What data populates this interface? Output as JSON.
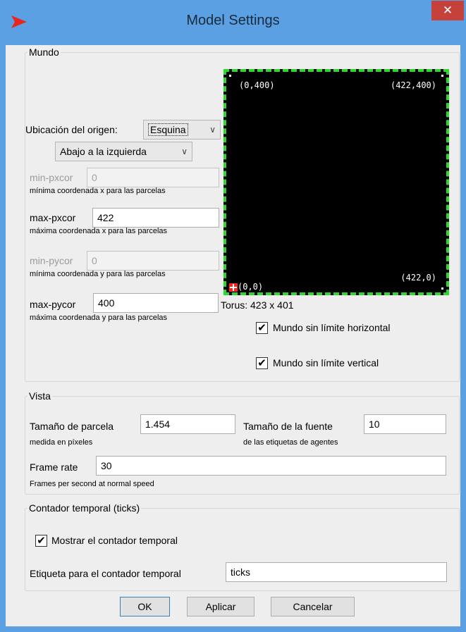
{
  "window": {
    "title": "Model Settings",
    "close_glyph": "✕"
  },
  "mundo": {
    "group_label": "Mundo",
    "origin_label": "Ubicación del origen:",
    "origin_combo": "Esquina",
    "origin_corner_combo": "Abajo a la izquierda",
    "min_pxcor": {
      "label": "min-pxcor",
      "value": "0",
      "hint": "mínima coordenada x para las parcelas"
    },
    "max_pxcor": {
      "label": "max-pxcor",
      "value": "422",
      "hint": "máxima coordenada x para las parcelas"
    },
    "min_pycor": {
      "label": "min-pycor",
      "value": "0",
      "hint": "mínima coordenada y para las parcelas"
    },
    "max_pycor": {
      "label": "max-pycor",
      "value": "400",
      "hint": "máxima coordenada y para las parcelas"
    },
    "preview": {
      "top_left": "(0,400)",
      "top_right": "(422,400)",
      "bottom_left": "(0,0)",
      "bottom_right": "(422,0)",
      "torus": "Torus: 423 x 401"
    },
    "wrap_horizontal": {
      "label": "Mundo sin límite horizontal",
      "checked": true
    },
    "wrap_vertical": {
      "label": "Mundo sin límite vertical",
      "checked": true
    }
  },
  "vista": {
    "group_label": "Vista",
    "patch_size": {
      "label": "Tamaño de parcela",
      "value": "1.454",
      "hint": "medida en píxeles"
    },
    "font_size": {
      "label": "Tamaño de la fuente",
      "value": "10",
      "hint": "de las etiquetas de agentes"
    },
    "frame_rate": {
      "label": "Frame rate",
      "value": "30",
      "hint": "Frames per second at normal speed"
    }
  },
  "ticks": {
    "group_label": "Contador temporal (ticks)",
    "show_counter": {
      "label": "Mostrar el contador temporal",
      "checked": true
    },
    "counter_label": {
      "label": "Etiqueta para el contador temporal",
      "value": "ticks"
    }
  },
  "buttons": {
    "ok": "OK",
    "apply": "Aplicar",
    "cancel": "Cancelar"
  },
  "colors": {
    "title_bar": "#5aa0e3",
    "close": "#c7413c",
    "world_border": "#2ed72e",
    "origin_marker": "#ff2020"
  },
  "icons": {
    "app": "netlogo-arrow-icon",
    "dropdown": "chevron-down-icon",
    "check": "checkmark-icon"
  }
}
